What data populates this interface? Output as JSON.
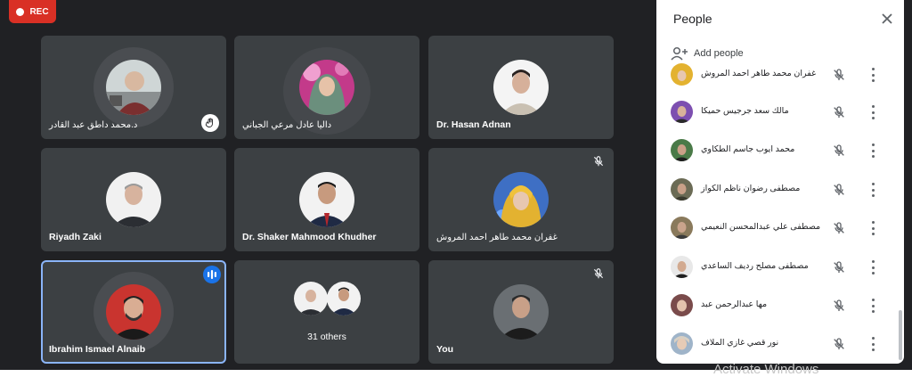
{
  "recording": {
    "label": "REC",
    "color": "#d93025"
  },
  "tiles": [
    {
      "name": "د.محمد داطق عبد القادر",
      "rtl": true,
      "hand_raised": true
    },
    {
      "name": "داليا عادل مرعي الجباني",
      "rtl": true
    },
    {
      "name": "Dr. Hasan Adnan"
    },
    {
      "name": "Riyadh Zaki"
    },
    {
      "name": "Dr. Shaker Mahmood Khudher"
    },
    {
      "name": "غفران محمد طاهر احمد المروش",
      "rtl": true,
      "muted": true
    },
    {
      "name": "Ibrahim Ismael Alnaib",
      "speaking": true
    },
    {
      "label": "31 others"
    },
    {
      "name": "You",
      "muted": true
    }
  ],
  "panel": {
    "title": "People",
    "add_people_label": "Add people",
    "participants": [
      {
        "name": "غفران محمد طاهر احمد المروش",
        "muted": true
      },
      {
        "name": "مالك سعد جرجيس حميكا",
        "muted": true
      },
      {
        "name": "محمد ايوب جاسم الطكاوي",
        "muted": true
      },
      {
        "name": "مصطفى رضوان ناظم الكواز",
        "muted": true
      },
      {
        "name": "مصطفى علي عبدالمحسن النعيمي",
        "muted": true
      },
      {
        "name": "مصطفى مصلح رديف الساعدي",
        "muted": true
      },
      {
        "name": "مها عبدالرحمن عبد",
        "muted": true
      },
      {
        "name": "نور قصي غازي الملاف",
        "muted": true
      }
    ]
  },
  "os_watermark": "Activate Windows",
  "colors": {
    "stage": "#202124",
    "tile": "#3c4043",
    "accent": "#1a73e8",
    "active_border": "#8ab4f8"
  },
  "icons": [
    "record-dot-icon",
    "hand-raise-icon",
    "speaking-icon",
    "mic-off-icon",
    "close-icon",
    "add-person-icon",
    "more-vert-icon"
  ]
}
